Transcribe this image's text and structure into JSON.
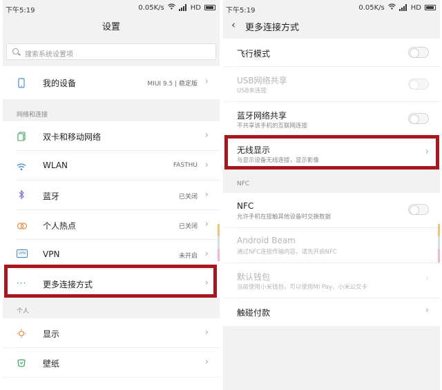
{
  "left": {
    "status": {
      "time": "下午5:19",
      "speed": "0.05K/s",
      "network": "HD"
    },
    "title": "设置",
    "search": {
      "placeholder": "搜索系统设置项"
    },
    "device": {
      "label": "我的设备",
      "value": "MIUI 9.5 | 稳定版"
    },
    "sections": {
      "network": "网络和连接",
      "personal": "个人"
    },
    "network_items": [
      {
        "label": "双卡和移动网络",
        "value": ""
      },
      {
        "label": "WLAN",
        "value": "FASTHU"
      },
      {
        "label": "蓝牙",
        "value": "已关闭"
      },
      {
        "label": "个人热点",
        "value": "已关闭"
      },
      {
        "label": "VPN",
        "value": "未开启"
      },
      {
        "label": "更多连接方式",
        "value": ""
      }
    ],
    "personal_items": [
      {
        "label": "显示"
      },
      {
        "label": "壁纸"
      }
    ],
    "vpn_badge": "VPN"
  },
  "right": {
    "status": {
      "time": "下午5:19",
      "speed": "0.05K/s",
      "network": "HD"
    },
    "title": "更多连接方式",
    "items": [
      {
        "title": "飞行模式",
        "subtitle": ""
      },
      {
        "title": "USB网络共享",
        "subtitle": "USB未连接"
      },
      {
        "title": "蓝牙网络共享",
        "subtitle": "不共享该手机的互联网连接"
      },
      {
        "title": "无线显示",
        "subtitle": "与显示设备无线连接，显示影像"
      }
    ],
    "nfc_section": "NFC",
    "nfc_items": [
      {
        "title": "NFC",
        "subtitle": "允许手机在接触其他设备时交换数据"
      },
      {
        "title": "Android Beam",
        "subtitle": "通过NFC连接传输内容，请先开启NFC"
      },
      {
        "title": "默认钱包",
        "subtitle": "当前使用小米钱包，可以使用MI Pay、小米公交卡"
      },
      {
        "title": "触碰付款",
        "subtitle": ""
      }
    ]
  },
  "colors": {
    "highlight": "#a8161e",
    "accent": "#3a86d6"
  }
}
